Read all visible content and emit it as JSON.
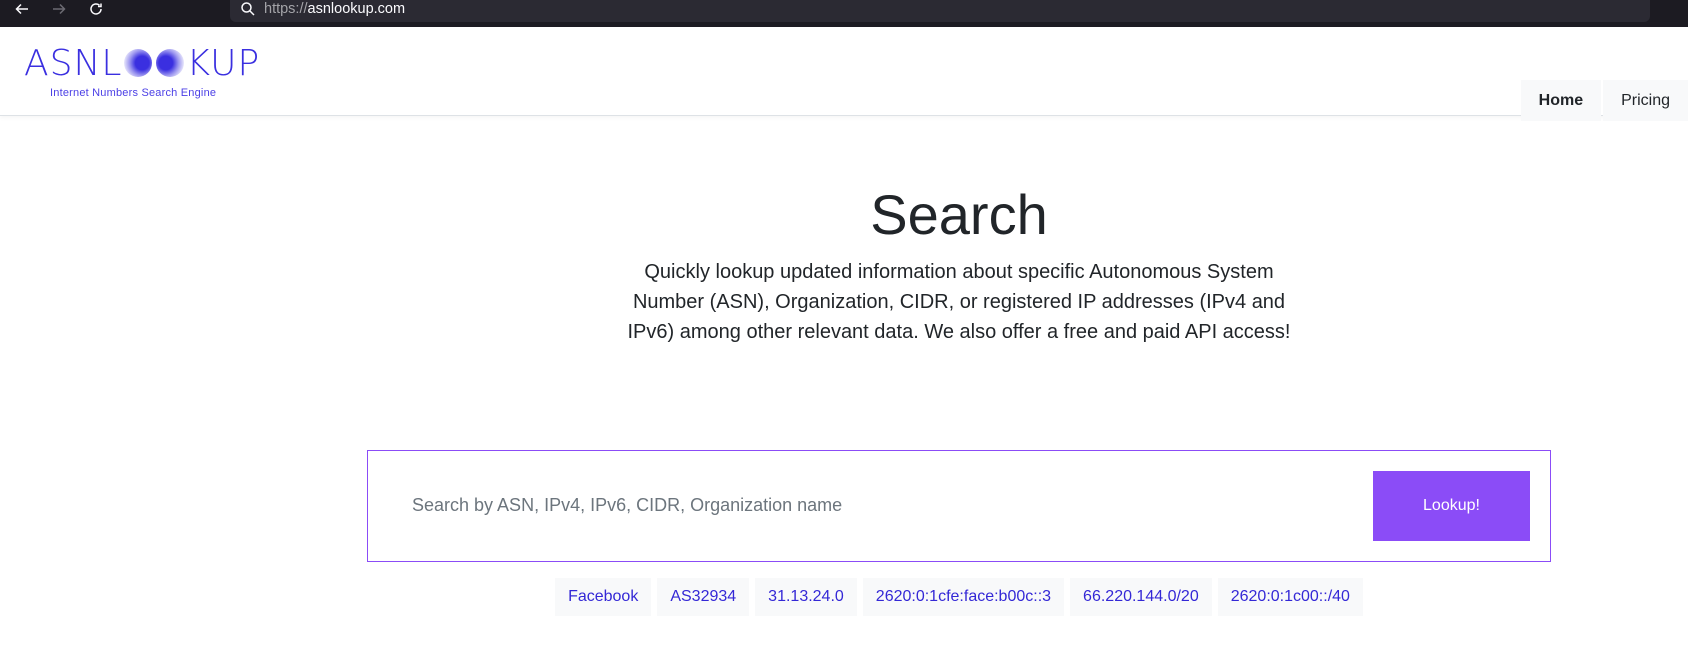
{
  "browser": {
    "url_scheme": "https://",
    "url_host": "asnlookup.com",
    "icons": [
      "back-arrow-icon",
      "forward-arrow-icon",
      "reload-icon",
      "search-icon"
    ]
  },
  "header": {
    "logo_left": "ASNL",
    "logo_right": "KUP",
    "tagline": "Internet Numbers Search Engine",
    "nav": [
      {
        "label": "Home",
        "active": true
      },
      {
        "label": "Pricing",
        "active": false
      }
    ]
  },
  "hero": {
    "title": "Search",
    "description": "Quickly lookup updated information about specific Autonomous System Number (ASN), Organization, CIDR, or registered IP addresses (IPv4 and IPv6) among other relevant data. We also offer a free and paid API access!"
  },
  "search": {
    "placeholder": "Search by ASN, IPv4, IPv6, CIDR, Organization name",
    "value": "",
    "button_label": "Lookup!"
  },
  "examples": [
    "Facebook",
    "AS32934",
    "31.13.24.0",
    "2620:0:1cfe:face:b00c::3",
    "66.220.144.0/20",
    "2620:0:1c00::/40"
  ],
  "colors": {
    "accent": "#8b4cf7",
    "brand": "#3a2fe0",
    "link": "#3428d6",
    "chrome": "#1c1b22"
  }
}
